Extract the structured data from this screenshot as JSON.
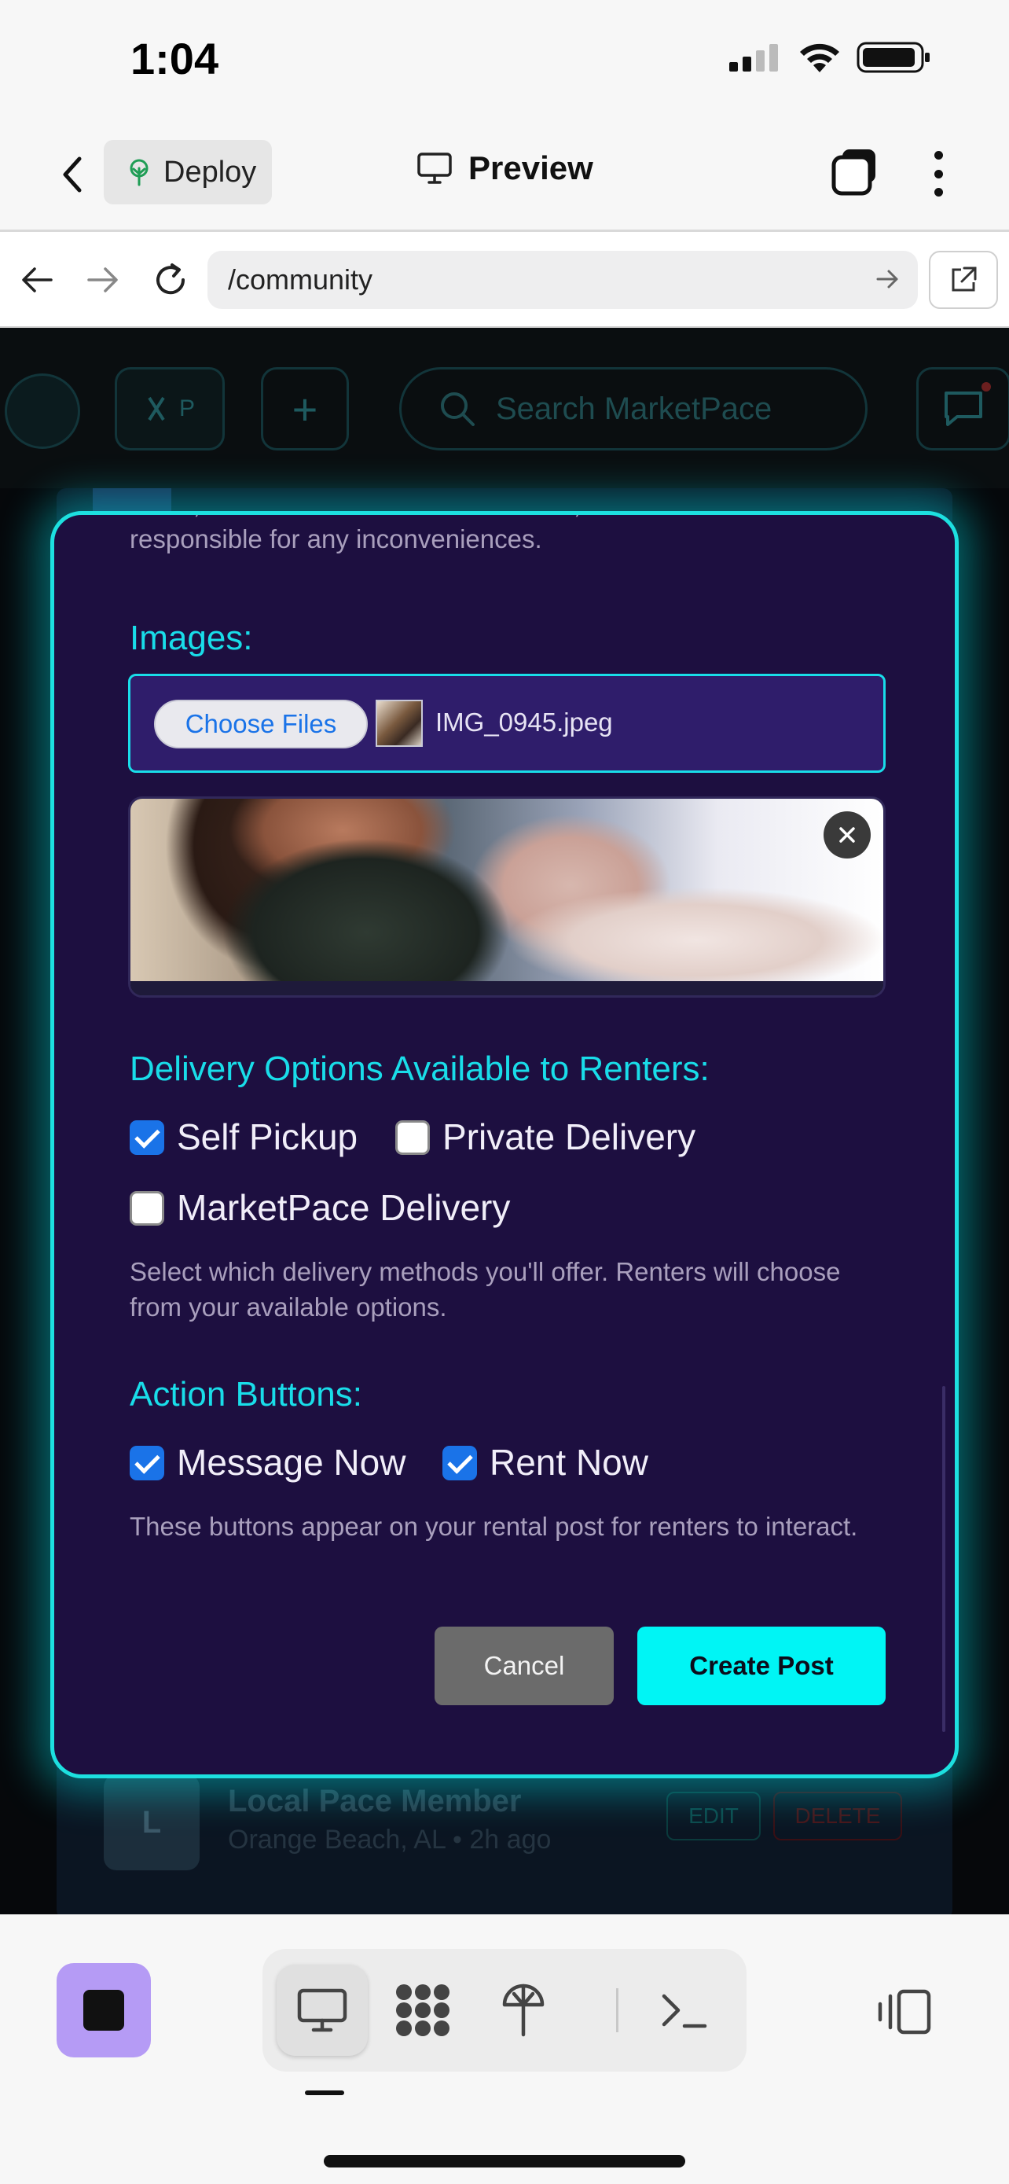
{
  "status_bar": {
    "time": "1:04"
  },
  "app_bar": {
    "deploy_label": "Deploy",
    "preview_label": "Preview"
  },
  "browser": {
    "url": "/community"
  },
  "page_header": {
    "search_placeholder": "Search MarketPace",
    "logo_text": "P"
  },
  "background_post": {
    "avatar_letter": "L",
    "name": "Local Pace Member",
    "meta": "Orange Beach, AL • 2h ago",
    "edit_label": "EDIT",
    "delete_label": "DELETE"
  },
  "modal": {
    "truncated_line_1": "driver, not associated with MarketPace, and we're not",
    "truncated_line_2": "responsible for any inconveniences.",
    "images_title": "Images:",
    "choose_files_label": "Choose Files",
    "file_name": "IMG_0945.jpeg",
    "delivery_title": "Delivery Options Available to Renters:",
    "delivery_options": [
      {
        "label": "Self Pickup",
        "checked": true
      },
      {
        "label": "Private Delivery",
        "checked": false
      },
      {
        "label": "MarketPace Delivery",
        "checked": false
      }
    ],
    "delivery_help": "Select which delivery methods you'll offer. Renters will choose from your available options.",
    "action_title": "Action Buttons:",
    "action_options": [
      {
        "label": "Message Now",
        "checked": true
      },
      {
        "label": "Rent Now",
        "checked": true
      }
    ],
    "action_help": "These buttons appear on your rental post for renters to interact.",
    "cancel_label": "Cancel",
    "create_label": "Create Post"
  },
  "colors": {
    "accent": "#19dde9",
    "modal_bg": "#1d0f40",
    "checkbox_on": "#1a73e8",
    "create_button": "#00f5f5"
  }
}
